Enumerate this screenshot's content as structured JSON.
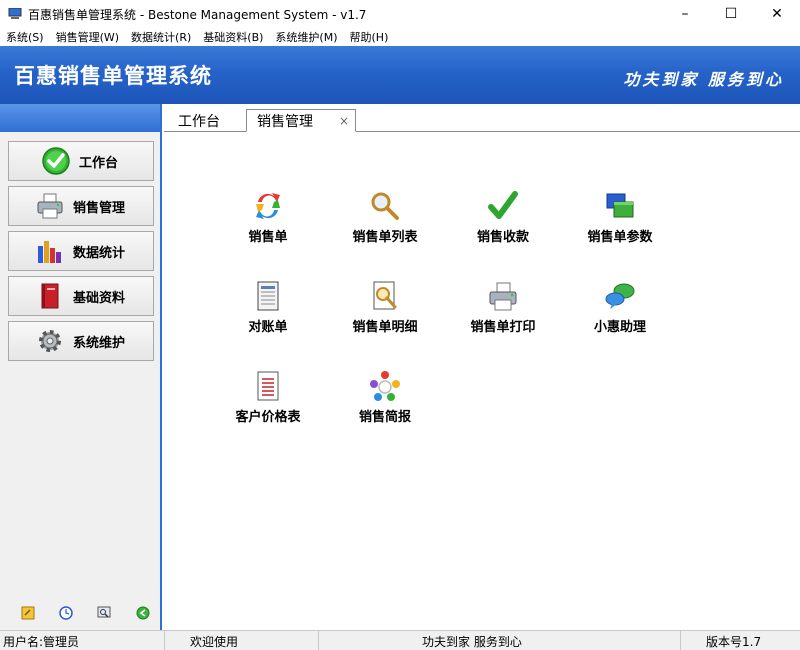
{
  "window": {
    "title": "百惠销售单管理系统 - Bestone Management System - v1.7",
    "minimize": "–",
    "maximize": "☐",
    "close": "✕"
  },
  "menu": [
    "系统(S)",
    "销售管理(W)",
    "数据统计(R)",
    "基础资料(B)",
    "系统维护(M)",
    "帮助(H)"
  ],
  "banner": {
    "title": "百惠销售单管理系统",
    "slogan": "功夫到家 服务到心"
  },
  "sidebar": {
    "items": [
      {
        "label": "工作台",
        "icon": "check-circle-icon"
      },
      {
        "label": "销售管理",
        "icon": "printer-icon"
      },
      {
        "label": "数据统计",
        "icon": "bar-chart-icon"
      },
      {
        "label": "基础资料",
        "icon": "book-icon"
      },
      {
        "label": "系统维护",
        "icon": "gear-icon"
      }
    ],
    "bottom_icons": [
      "key-icon",
      "clock-icon",
      "search-window-icon",
      "back-arrow-icon"
    ]
  },
  "tabs": [
    {
      "label": "工作台"
    },
    {
      "label": "销售管理",
      "close": "×"
    }
  ],
  "functions": [
    {
      "label": "销售单",
      "icon": "refresh-arrows-icon"
    },
    {
      "label": "销售单列表",
      "icon": "magnifier-icon"
    },
    {
      "label": "销售收款",
      "icon": "checkmark-icon"
    },
    {
      "label": "销售单参数",
      "icon": "windows-icon"
    },
    {
      "label": "对账单",
      "icon": "ledger-icon"
    },
    {
      "label": "销售单明细",
      "icon": "document-search-icon"
    },
    {
      "label": "销售单打印",
      "icon": "printer-icon"
    },
    {
      "label": "小惠助理",
      "icon": "chat-bubbles-icon"
    },
    {
      "label": "客户价格表",
      "icon": "price-list-icon"
    },
    {
      "label": "销售简报",
      "icon": "cycle-icon"
    }
  ],
  "status": {
    "user": "用户名:管理员",
    "welcome": "欢迎使用",
    "slogan": "功夫到家 服务到心",
    "version": "版本号1.7"
  }
}
